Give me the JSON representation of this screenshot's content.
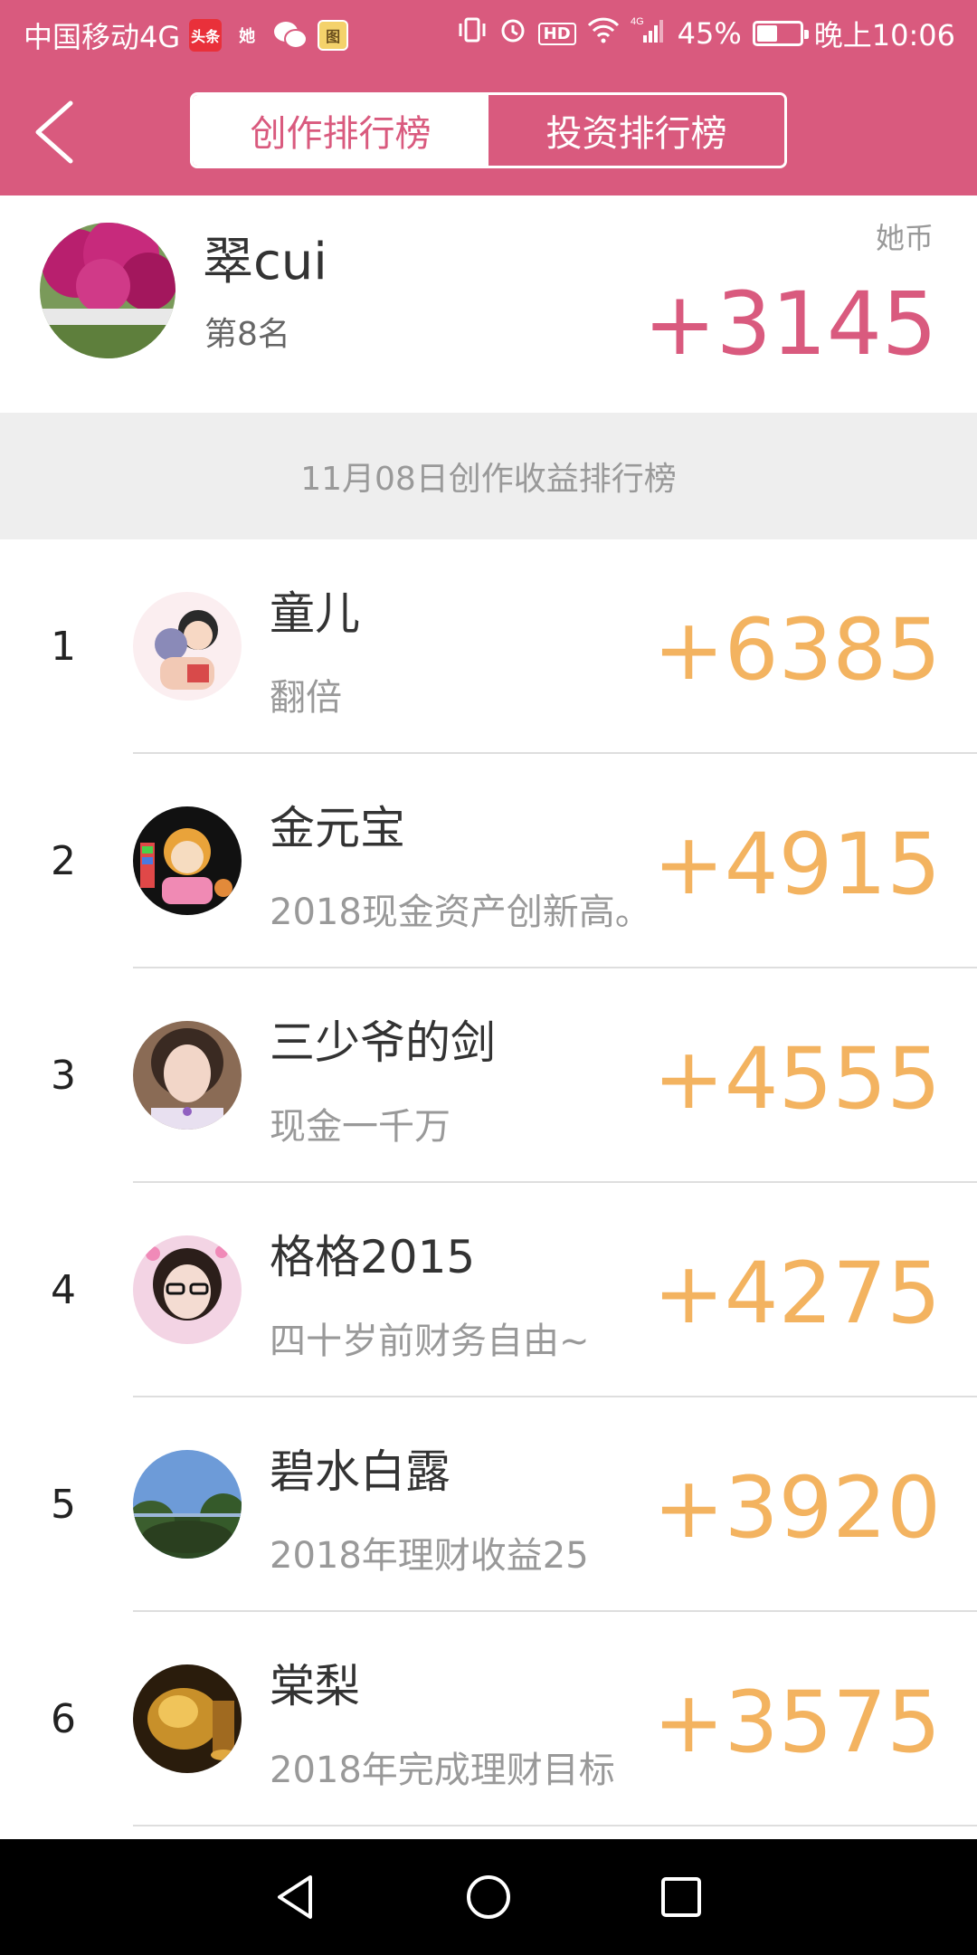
{
  "status_bar": {
    "carrier": "中国移动4G",
    "battery_text": "45%",
    "battery_level": 0.45,
    "time": "晚上10:06",
    "hd": "HD",
    "network": "4G",
    "app_icons": [
      "toutiao-icon",
      "ta-app-icon",
      "wechat-icon",
      "misc-app-icon"
    ],
    "status_icons": [
      "vibrate-icon",
      "alarm-icon",
      "hd-icon",
      "wifi-icon",
      "signal-icon",
      "battery-icon"
    ]
  },
  "header": {
    "back_icon": "chevron-left-icon",
    "tabs": [
      {
        "label": "创作排行榜",
        "active": true
      },
      {
        "label": "投资排行榜",
        "active": false
      }
    ]
  },
  "me": {
    "name": "翠cui",
    "rank": "第8名",
    "coin_label": "她币",
    "score": "+3145"
  },
  "date_banner": "11月08日创作收益排行榜",
  "ranking": [
    {
      "rank": "1",
      "name": "童儿",
      "motto": "翻倍",
      "score": "+6385"
    },
    {
      "rank": "2",
      "name": "金元宝",
      "motto": "2018现金资产创新高。",
      "score": "+4915"
    },
    {
      "rank": "3",
      "name": "三少爷的剑",
      "motto": "现金一千万",
      "score": "+4555"
    },
    {
      "rank": "4",
      "name": "格格2015",
      "motto": "四十岁前财务自由~",
      "score": "+4275"
    },
    {
      "rank": "5",
      "name": "碧水白露",
      "motto": "2018年理财收益25",
      "score": "+3920"
    },
    {
      "rank": "6",
      "name": "棠梨",
      "motto": "2018年完成理财目标",
      "score": "+3575"
    }
  ],
  "colors": {
    "brand": "#d95a7e",
    "score_orange": "#f3b360",
    "banner_bg": "#eeeeee"
  },
  "nav": [
    "back-triangle-icon",
    "home-circle-icon",
    "recents-square-icon"
  ]
}
